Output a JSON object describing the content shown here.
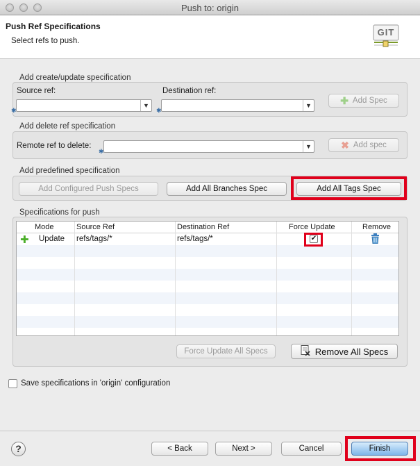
{
  "window": {
    "title": "Push to: origin"
  },
  "header": {
    "title": "Push Ref Specifications",
    "subtitle": "Select refs to push.",
    "logo_text": "GIT"
  },
  "create_update": {
    "group_label": "Add create/update specification",
    "source_label": "Source ref:",
    "destination_label": "Destination ref:",
    "add_spec_button": "Add Spec"
  },
  "delete_ref": {
    "group_label": "Add delete ref specification",
    "remote_label": "Remote ref to delete:",
    "add_spec_button": "Add spec"
  },
  "predefined": {
    "group_label": "Add predefined specification",
    "configured_button": "Add Configured Push Specs",
    "branches_button": "Add All Branches Spec",
    "tags_button": "Add All Tags Spec"
  },
  "specs": {
    "group_label": "Specifications for push",
    "columns": [
      "Mode",
      "Source Ref",
      "Destination Ref",
      "Force Update",
      "Remove"
    ],
    "rows": [
      {
        "mode": "Update",
        "source": "refs/tags/*",
        "destination": "refs/tags/*",
        "force": "✔"
      }
    ],
    "force_all_button": "Force Update All Specs",
    "remove_all_button": "Remove All Specs"
  },
  "save_config": {
    "label": "Save specifications in 'origin' configuration"
  },
  "footer": {
    "help": "?",
    "back_button": "< Back",
    "next_button": "Next >",
    "cancel_button": "Cancel",
    "finish_button": "Finish"
  },
  "colors": {
    "highlight": "#e0001b",
    "add_icon": "#4caf2a",
    "remove_icon": "#d84a3a",
    "trash_icon": "#3a7fc0"
  }
}
